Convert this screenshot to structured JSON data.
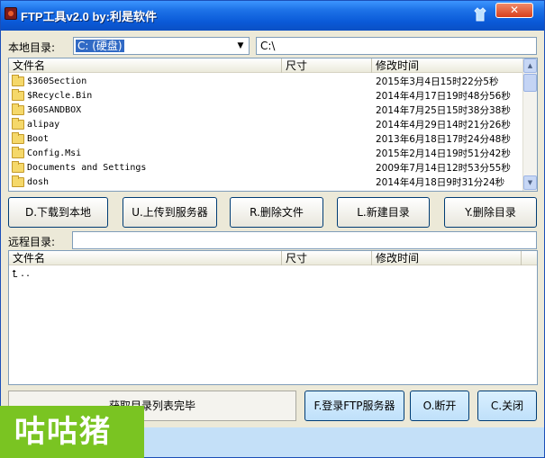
{
  "window": {
    "title": "FTP工具v2.0  by:利是软件",
    "close_label": "✕"
  },
  "local": {
    "dir_label": "本地目录:",
    "drive_value": "C: (硬盘)",
    "path_value": "C:\\"
  },
  "local_list": {
    "columns": [
      "文件名",
      "尺寸",
      "修改时间"
    ],
    "rows": [
      {
        "name": "$360Section",
        "size": "",
        "time": "2015年3月4日15时22分5秒"
      },
      {
        "name": "$Recycle.Bin",
        "size": "",
        "time": "2014年4月17日19时48分56秒"
      },
      {
        "name": "360SANDBOX",
        "size": "",
        "time": "2014年7月25日15时38分38秒"
      },
      {
        "name": "alipay",
        "size": "",
        "time": "2014年4月29日14时21分26秒"
      },
      {
        "name": "Boot",
        "size": "",
        "time": "2013年6月18日17时24分48秒"
      },
      {
        "name": "Config.Msi",
        "size": "",
        "time": "2015年2月14日19时51分42秒"
      },
      {
        "name": "Documents and Settings",
        "size": "",
        "time": "2009年7月14日12时53分55秒"
      },
      {
        "name": "dosh",
        "size": "",
        "time": "2014年4月18日9时31分24秒"
      }
    ]
  },
  "actions": {
    "download": "D.下载到本地",
    "upload": "U.上传到服务器",
    "delete_file": "R.删除文件",
    "new_dir": "L.新建目录",
    "delete_dir": "Y.删除目录"
  },
  "remote": {
    "dir_label": "远程目录:",
    "path_value": ""
  },
  "remote_list": {
    "columns": [
      "文件名",
      "尺寸",
      "修改时间"
    ],
    "rows": [
      {
        "name": "..",
        "size": "",
        "time": ""
      }
    ]
  },
  "status": {
    "text": "获取目录列表完毕"
  },
  "bottom_buttons": {
    "login": "F.登录FTP服务器",
    "disconnect": "O.断开",
    "close": "C.关闭"
  },
  "watermark": {
    "text": "咕咕猪"
  },
  "icons": {
    "app": "ftp-app-icon",
    "skin": "shirt-icon",
    "folder": "folder-icon",
    "parent": "up-arrow-icon",
    "dropdown": "chevron-down-icon"
  },
  "colors": {
    "titlebar": "#0a5ad8",
    "selection": "#316ac5",
    "watermark_bg": "#7ac422"
  }
}
